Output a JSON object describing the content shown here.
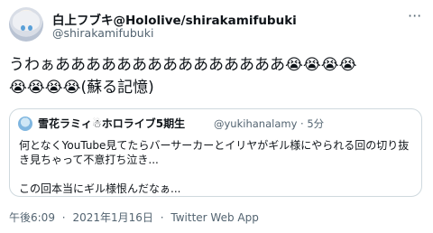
{
  "tweet": {
    "display_name": "白上フブキ@Hololive/shirakamifubuki",
    "handle": "@shirakamifubuki",
    "more_icon": "more-horizontal-icon",
    "text": "うわぁあああああああああああああああ😭😭😭😭\n😭😭😭😭(蘇る記憶)"
  },
  "quote": {
    "name": "雪花ラミィ☃ホロライブ5期生",
    "handle": "@yukihanalamy · 5分",
    "text": "何となくYouTube見てたらバーサーカーとイリヤがギル様にやられる回の切り抜き見ちゃって不意打ち泣き...\n\nこの回本当にギル様恨んだなぁ..."
  },
  "meta": {
    "time": "午後6:09",
    "sep1": "·",
    "date": "2021年1月16日",
    "sep2": "·",
    "source": "Twitter Web App"
  },
  "colors": {
    "text": "#0f1419",
    "secondary": "#536471",
    "border": "#cfd9de"
  }
}
